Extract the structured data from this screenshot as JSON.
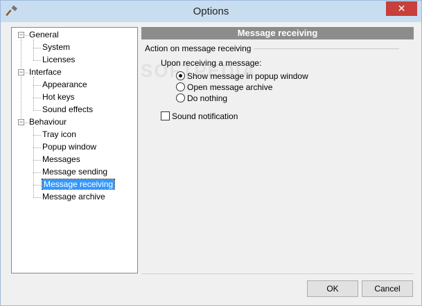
{
  "window": {
    "title": "Options",
    "close_glyph": "✕"
  },
  "tree": {
    "items": [
      {
        "label": "General",
        "level": 0,
        "expander": "−"
      },
      {
        "label": "System",
        "level": 1
      },
      {
        "label": "Licenses",
        "level": 1
      },
      {
        "label": "Interface",
        "level": 0,
        "expander": "−"
      },
      {
        "label": "Appearance",
        "level": 1
      },
      {
        "label": "Hot keys",
        "level": 1
      },
      {
        "label": "Sound effects",
        "level": 1
      },
      {
        "label": "Behaviour",
        "level": 0,
        "expander": "−"
      },
      {
        "label": "Tray icon",
        "level": 1
      },
      {
        "label": "Popup window",
        "level": 1
      },
      {
        "label": "Messages",
        "level": 1
      },
      {
        "label": "Message sending",
        "level": 1
      },
      {
        "label": "Message receiving",
        "level": 1,
        "selected": true
      },
      {
        "label": "Message archive",
        "level": 1
      }
    ]
  },
  "panel": {
    "header": "Message receiving",
    "group_label": "Action on message receiving",
    "sub_label": "Upon receiving a message:",
    "radios": [
      {
        "label": "Show message in popup window",
        "checked": true
      },
      {
        "label": "Open message archive",
        "checked": false
      },
      {
        "label": "Do nothing",
        "checked": false
      }
    ],
    "checkbox": {
      "label": "Sound notification",
      "checked": false
    }
  },
  "buttons": {
    "ok": "OK",
    "cancel": "Cancel"
  },
  "watermark": "SOFTPEDIA",
  "colors": {
    "title_bar": "#c9ddf1",
    "close": "#c7403c",
    "selection": "#3399ff",
    "header": "#8c8c8c"
  }
}
